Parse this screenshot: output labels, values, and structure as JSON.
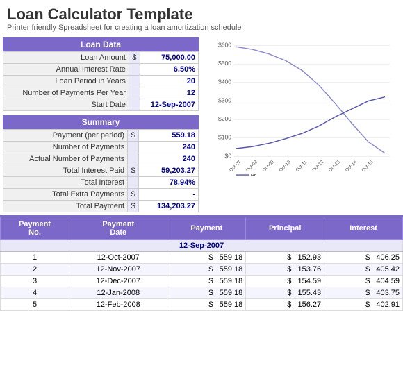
{
  "header": {
    "title": "Loan Calculator Template",
    "subtitle": "Printer friendly Spreadsheet for creating a loan amortization schedule"
  },
  "loan_data": {
    "section_title": "Loan Data",
    "rows": [
      {
        "label": "Loan Amount",
        "symbol": "$",
        "value": "75,000.00"
      },
      {
        "label": "Annual Interest Rate",
        "symbol": "",
        "value": "6.50%"
      },
      {
        "label": "Loan Period in Years",
        "symbol": "",
        "value": "20"
      },
      {
        "label": "Number of Payments Per Year",
        "symbol": "",
        "value": "12"
      },
      {
        "label": "Start Date",
        "symbol": "",
        "value": "12-Sep-2007"
      }
    ]
  },
  "summary": {
    "section_title": "Summary",
    "rows": [
      {
        "label": "Payment (per period)",
        "symbol": "$",
        "value": "559.18"
      },
      {
        "label": "Number of Payments",
        "symbol": "",
        "value": "240"
      },
      {
        "label": "Actual Number of Payments",
        "symbol": "",
        "value": "240"
      },
      {
        "label": "Total Interest Paid",
        "symbol": "$",
        "value": "59,203.27"
      },
      {
        "label": "Total Interest",
        "symbol": "",
        "value": "78.94%"
      },
      {
        "label": "Total Extra Payments",
        "symbol": "$",
        "value": "-"
      },
      {
        "label": "Total Payment",
        "symbol": "$",
        "value": "134,203.27"
      }
    ]
  },
  "amortization": {
    "columns": [
      "Payment No.",
      "Payment Date",
      "Payment",
      "Principal",
      "Interest"
    ],
    "start_date_label": "12-Sep-2007",
    "rows": [
      {
        "no": "1",
        "date": "12-Oct-2007",
        "payment": "559.18",
        "principal": "152.93",
        "interest": "406.25"
      },
      {
        "no": "2",
        "date": "12-Nov-2007",
        "payment": "559.18",
        "principal": "153.76",
        "interest": "405.42"
      },
      {
        "no": "3",
        "date": "12-Dec-2007",
        "payment": "559.18",
        "principal": "154.59",
        "interest": "404.59"
      },
      {
        "no": "4",
        "date": "12-Jan-2008",
        "payment": "559.18",
        "principal": "155.43",
        "interest": "403.75"
      },
      {
        "no": "5",
        "date": "12-Feb-2008",
        "payment": "559.18",
        "principal": "156.27",
        "interest": "402.91"
      }
    ]
  },
  "chart": {
    "y_labels": [
      "$600",
      "$500",
      "$400",
      "$300",
      "$200",
      "$100",
      "$0"
    ],
    "x_labels": [
      "Oct-07",
      "Oct-08",
      "Oct-09",
      "Oct-10",
      "Oct-11",
      "Oct-12",
      "Oct-13",
      "Oct-14",
      "Oct-15"
    ],
    "legend": "Pr..."
  },
  "colors": {
    "header_bg": "#7B68C8",
    "accent": "#00008B",
    "row_even": "#f5f5ff",
    "row_odd": "#ffffff"
  }
}
